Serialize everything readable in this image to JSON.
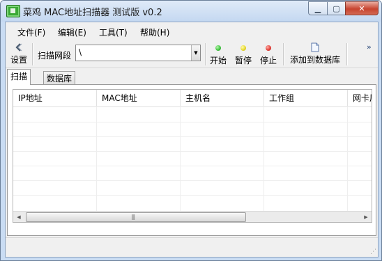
{
  "window": {
    "title": "菜鸡 MAC地址扫描器 测试版 v0.2"
  },
  "menu": [
    "文件(F)",
    "编辑(E)",
    "工具(T)",
    "帮助(H)"
  ],
  "toolbar": {
    "settings_label": "设置",
    "scan_range_label": "扫描网段",
    "scan_range_value": "\\",
    "start_label": "开始",
    "pause_label": "暂停",
    "stop_label": "停止",
    "add_db_label": "添加到数据库"
  },
  "tabs": [
    "扫描",
    "数据库"
  ],
  "table": {
    "columns": [
      "IP地址",
      "MAC地址",
      "主机名",
      "工作组",
      "网卡厂"
    ]
  },
  "colors": {
    "start": "#3cc23c",
    "pause": "#e6d72a",
    "stop": "#e03a33"
  }
}
